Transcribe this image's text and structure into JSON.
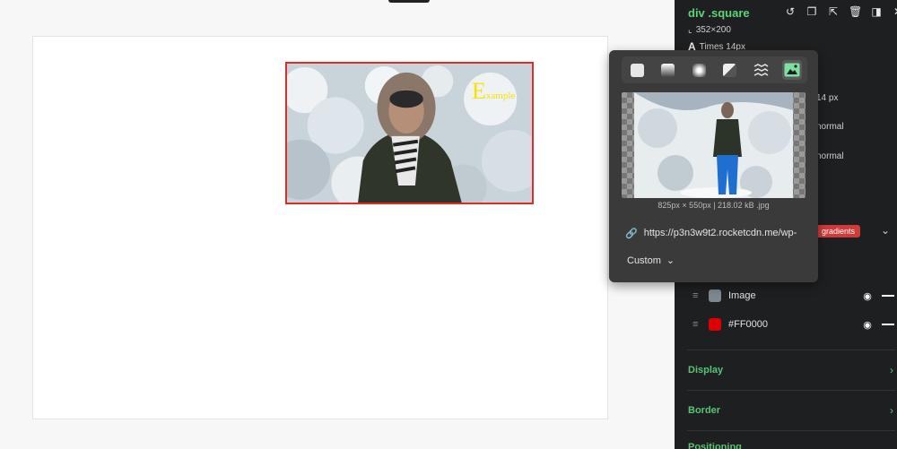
{
  "canvas": {
    "example_big_letter": "E",
    "example_rest": "xample"
  },
  "panel": {
    "selector_title": "div .square",
    "element_size": "352×200",
    "font_glyph": "A",
    "font_info": "Times 14px",
    "behind_px": "14  px",
    "behind_r": "r",
    "behind_normal_1": "normal",
    "behind_normal_2": "normal",
    "gradients_badge": "gradients",
    "layers": [
      {
        "label": "Image"
      },
      {
        "label": "#FF0000"
      }
    ],
    "sections": [
      {
        "title": "Display"
      },
      {
        "title": "Border"
      },
      {
        "title": "Positioning"
      }
    ]
  },
  "popover": {
    "image_info": "825px × 550px | 218.02 kB .jpg",
    "url": "https://p3n3w9t2.rocketcdn.me/wp-",
    "mode": "Custom"
  },
  "colors": {
    "accent_green": "#5fd37a",
    "selection_red": "#e02b2b",
    "badge_red": "#d13a3a",
    "layer_color": "#FF0000",
    "example_yellow": "#f5e400"
  }
}
